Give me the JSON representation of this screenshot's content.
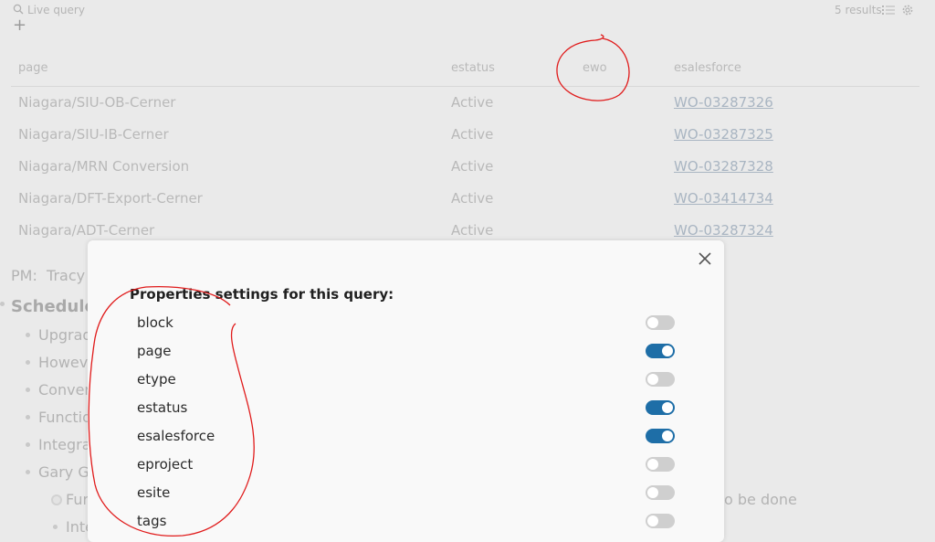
{
  "topbar": {
    "live_query": "Live query",
    "add": "+",
    "results": "5 results"
  },
  "table": {
    "headers": [
      "page",
      "estatus",
      "ewo",
      "esalesforce"
    ],
    "rows": [
      {
        "page": "Niagara/SIU-OB-Cerner",
        "estatus": "Active",
        "esalesforce": "WO-03287326"
      },
      {
        "page": "Niagara/SIU-IB-Cerner",
        "estatus": "Active",
        "esalesforce": "WO-03287325"
      },
      {
        "page": "Niagara/MRN Conversion",
        "estatus": "Active",
        "esalesforce": "WO-03287328"
      },
      {
        "page": "Niagara/DFT-Export-Cerner",
        "estatus": "Active",
        "esalesforce": "WO-03414734"
      },
      {
        "page": "Niagara/ADT-Cerner",
        "estatus": "Active",
        "esalesforce": "WO-03287324"
      }
    ]
  },
  "background": {
    "pm_label": "PM:",
    "pm_value": "Tracy",
    "schedule": "Schedule",
    "items": [
      "Upgrad",
      "Howeve",
      "Conver",
      "Functio",
      "Integra",
      "Gary G"
    ],
    "sub_items": [
      "Fur",
      "Inte"
    ],
    "trailing_text": "o be done"
  },
  "modal": {
    "title": "Properties settings for this query:",
    "properties": [
      {
        "name": "block",
        "enabled": false
      },
      {
        "name": "page",
        "enabled": true
      },
      {
        "name": "etype",
        "enabled": false
      },
      {
        "name": "estatus",
        "enabled": true
      },
      {
        "name": "esalesforce",
        "enabled": true
      },
      {
        "name": "eproject",
        "enabled": false
      },
      {
        "name": "esite",
        "enabled": false
      },
      {
        "name": "tags",
        "enabled": false
      }
    ]
  },
  "colors": {
    "toggle_on": "#1e6ea7",
    "toggle_off": "#cfcfcf",
    "annotation": "#e01b1b"
  }
}
